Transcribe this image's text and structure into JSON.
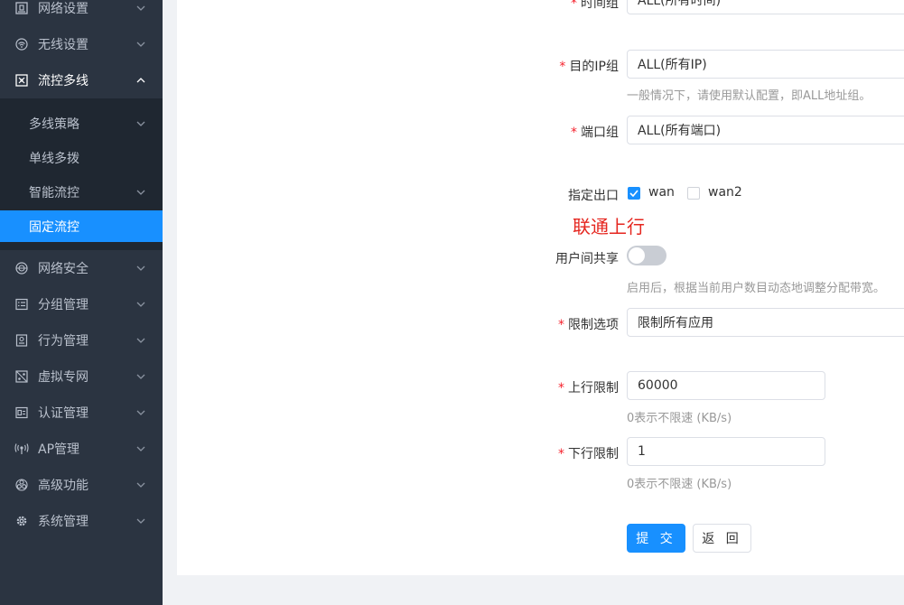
{
  "sidebar": {
    "items_top": [
      {
        "label": "网络设置",
        "icon": "building-icon"
      },
      {
        "label": "无线设置",
        "icon": "wifi-icon"
      },
      {
        "label": "流控多线",
        "icon": "flow-control-icon"
      }
    ],
    "submenu": [
      {
        "label": "多线策略"
      },
      {
        "label": "单线多拨"
      },
      {
        "label": "智能流控"
      },
      {
        "label": "固定流控"
      }
    ],
    "items_bottom": [
      {
        "label": "网络安全",
        "icon": "globe-shield-icon"
      },
      {
        "label": "分组管理",
        "icon": "group-list-icon"
      },
      {
        "label": "行为管理",
        "icon": "behavior-icon"
      },
      {
        "label": "虚拟专网",
        "icon": "vpn-icon"
      },
      {
        "label": "认证管理",
        "icon": "auth-icon"
      },
      {
        "label": "AP管理",
        "icon": "ap-antenna-icon"
      },
      {
        "label": "高级功能",
        "icon": "fan-icon"
      },
      {
        "label": "系统管理",
        "icon": "gear-icon"
      }
    ],
    "active_item": "固定流控",
    "active_color": "#1890ff"
  },
  "form": {
    "time_group": {
      "label": "时间组",
      "value": "ALL(所有时间)"
    },
    "dest_ip_group": {
      "label": "目的IP组",
      "value": "ALL(所有IP)",
      "hint": "一般情况下，请使用默认配置，即ALL地址组。"
    },
    "port_group": {
      "label": "端口组",
      "value": "ALL(所有端口)"
    },
    "outlet": {
      "label": "指定出口",
      "options": [
        {
          "label": "wan",
          "checked": true
        },
        {
          "label": "wan2",
          "checked": false
        }
      ]
    },
    "annotation": "联通上行",
    "user_share": {
      "label": "用户间共享",
      "enabled": false,
      "hint": "启用后，根据当前用户数目动态地调整分配带宽。"
    },
    "limit_option": {
      "label": "限制选项",
      "value": "限制所有应用"
    },
    "up_limit": {
      "label": "上行限制",
      "value": "60000",
      "hint": "0表示不限速 (KB/s)"
    },
    "down_limit": {
      "label": "下行限制",
      "value": "1",
      "hint": "0表示不限速 (KB/s)"
    },
    "required_mark": "*",
    "submit_label": "提 交",
    "back_label": "返 回"
  }
}
